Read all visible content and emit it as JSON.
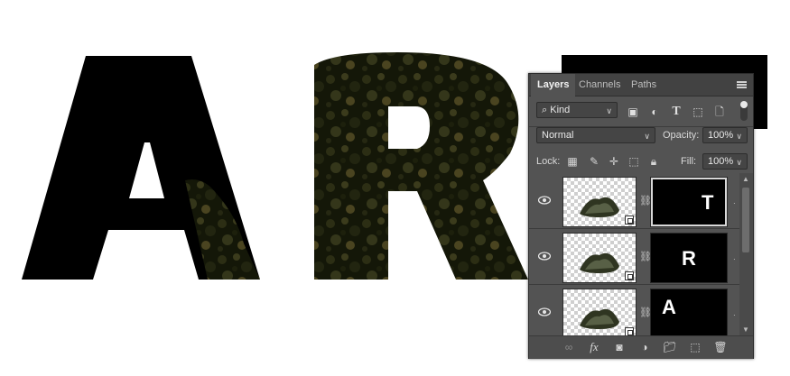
{
  "panel": {
    "tabs": [
      "Layers",
      "Channels",
      "Paths"
    ],
    "filter_kind": "Kind",
    "blend_mode": "Normal",
    "opacity_label": "Opacity:",
    "opacity_value": "100%",
    "lock_label": "Lock:",
    "fill_label": "Fill:",
    "fill_value": "100%"
  },
  "layers": [
    {
      "mask_letter": "T",
      "visible": true,
      "selected": true
    },
    {
      "mask_letter": "R",
      "visible": true,
      "selected": false
    },
    {
      "mask_letter": "A",
      "visible": true,
      "selected": false
    }
  ],
  "canvas": {
    "letters": [
      "A",
      "R"
    ],
    "colors": {
      "letter_fill": "#000000",
      "foliage_dark": "#1a1e0e",
      "foliage_mid": "#3b3a1a"
    }
  },
  "icons": {
    "filter": [
      "image-filter-icon",
      "adjustment-filter-icon",
      "type-filter-icon",
      "shape-filter-icon",
      "smart-object-filter-icon"
    ],
    "lock": [
      "lock-transparent-icon",
      "lock-image-icon",
      "lock-position-icon",
      "lock-artboard-icon",
      "lock-all-icon"
    ],
    "footer": [
      "link-layers-icon",
      "fx-icon",
      "add-mask-icon",
      "adjustment-layer-icon",
      "group-icon",
      "new-layer-icon",
      "delete-icon"
    ],
    "fx_label": "fx"
  }
}
